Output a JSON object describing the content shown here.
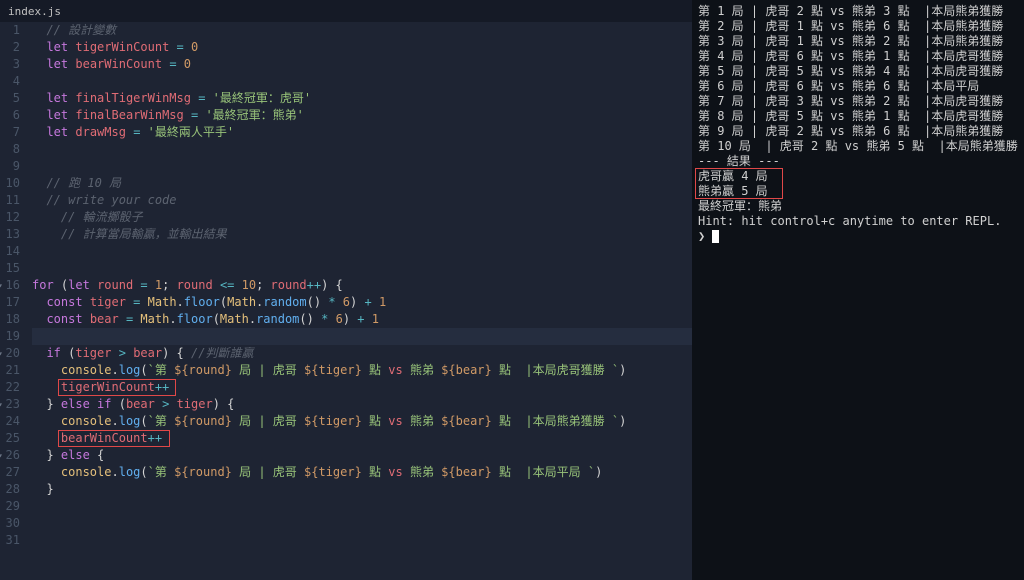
{
  "tab": {
    "filename": "index.js"
  },
  "code": {
    "lines": [
      {
        "n": 1,
        "seg": [
          [
            "",
            "  "
          ],
          [
            "cmt",
            "// 設計變數"
          ]
        ]
      },
      {
        "n": 2,
        "seg": [
          [
            "",
            "  "
          ],
          [
            "kw",
            "let"
          ],
          [
            "",
            " "
          ],
          [
            "var",
            "tigerWinCount"
          ],
          [
            "",
            " "
          ],
          [
            "op",
            "="
          ],
          [
            "",
            " "
          ],
          [
            "num",
            "0"
          ]
        ]
      },
      {
        "n": 3,
        "seg": [
          [
            "",
            "  "
          ],
          [
            "kw",
            "let"
          ],
          [
            "",
            " "
          ],
          [
            "var",
            "bearWinCount"
          ],
          [
            "",
            " "
          ],
          [
            "op",
            "="
          ],
          [
            "",
            " "
          ],
          [
            "num",
            "0"
          ]
        ]
      },
      {
        "n": 4,
        "seg": []
      },
      {
        "n": 5,
        "seg": [
          [
            "",
            "  "
          ],
          [
            "kw",
            "let"
          ],
          [
            "",
            " "
          ],
          [
            "var",
            "finalTigerWinMsg"
          ],
          [
            "",
            " "
          ],
          [
            "op",
            "="
          ],
          [
            "",
            " "
          ],
          [
            "str",
            "'最終冠軍：虎哥'"
          ]
        ]
      },
      {
        "n": 6,
        "seg": [
          [
            "",
            "  "
          ],
          [
            "kw",
            "let"
          ],
          [
            "",
            " "
          ],
          [
            "var",
            "finalBearWinMsg"
          ],
          [
            "",
            " "
          ],
          [
            "op",
            "="
          ],
          [
            "",
            " "
          ],
          [
            "str",
            "'最終冠軍：熊弟'"
          ]
        ]
      },
      {
        "n": 7,
        "seg": [
          [
            "",
            "  "
          ],
          [
            "kw",
            "let"
          ],
          [
            "",
            " "
          ],
          [
            "var",
            "drawMsg"
          ],
          [
            "",
            " "
          ],
          [
            "op",
            "="
          ],
          [
            "",
            " "
          ],
          [
            "str",
            "'最終兩人平手'"
          ]
        ]
      },
      {
        "n": 8,
        "seg": []
      },
      {
        "n": 9,
        "seg": []
      },
      {
        "n": 10,
        "seg": [
          [
            "",
            "  "
          ],
          [
            "cmt",
            "// 跑 10 局"
          ]
        ]
      },
      {
        "n": 11,
        "seg": [
          [
            "",
            "  "
          ],
          [
            "cmt",
            "// write your code"
          ]
        ]
      },
      {
        "n": 12,
        "seg": [
          [
            "",
            "    "
          ],
          [
            "cmt",
            "// 輪流擲骰子"
          ]
        ]
      },
      {
        "n": 13,
        "seg": [
          [
            "",
            "    "
          ],
          [
            "cmt",
            "// 計算當局輸贏，並輸出結果"
          ]
        ]
      },
      {
        "n": 14,
        "seg": []
      },
      {
        "n": 15,
        "seg": []
      },
      {
        "n": 16,
        "fold": true,
        "seg": [
          [
            "kw",
            "for"
          ],
          [
            "",
            " ("
          ],
          [
            "kw",
            "let"
          ],
          [
            "",
            " "
          ],
          [
            "var",
            "round"
          ],
          [
            "",
            " "
          ],
          [
            "op",
            "="
          ],
          [
            "",
            " "
          ],
          [
            "num",
            "1"
          ],
          [
            "",
            "; "
          ],
          [
            "var",
            "round"
          ],
          [
            "",
            " "
          ],
          [
            "op",
            "<="
          ],
          [
            "",
            " "
          ],
          [
            "num",
            "10"
          ],
          [
            "",
            "; "
          ],
          [
            "var",
            "round"
          ],
          [
            "op",
            "++"
          ],
          [
            "",
            ") {"
          ]
        ]
      },
      {
        "n": 17,
        "seg": [
          [
            "",
            "  "
          ],
          [
            "kw",
            "const"
          ],
          [
            "",
            " "
          ],
          [
            "var",
            "tiger"
          ],
          [
            "",
            " "
          ],
          [
            "op",
            "="
          ],
          [
            "",
            " "
          ],
          [
            "prop",
            "Math"
          ],
          [
            "",
            "."
          ],
          [
            "fn",
            "floor"
          ],
          [
            "",
            "("
          ],
          [
            "prop",
            "Math"
          ],
          [
            "",
            "."
          ],
          [
            "fn",
            "random"
          ],
          [
            "",
            "() "
          ],
          [
            "op",
            "*"
          ],
          [
            "",
            " "
          ],
          [
            "num",
            "6"
          ],
          [
            "",
            ") "
          ],
          [
            "op",
            "+"
          ],
          [
            "",
            " "
          ],
          [
            "num",
            "1"
          ]
        ]
      },
      {
        "n": 18,
        "seg": [
          [
            "",
            "  "
          ],
          [
            "kw",
            "const"
          ],
          [
            "",
            " "
          ],
          [
            "var",
            "bear"
          ],
          [
            "",
            " "
          ],
          [
            "op",
            "="
          ],
          [
            "",
            " "
          ],
          [
            "prop",
            "Math"
          ],
          [
            "",
            "."
          ],
          [
            "fn",
            "floor"
          ],
          [
            "",
            "("
          ],
          [
            "prop",
            "Math"
          ],
          [
            "",
            "."
          ],
          [
            "fn",
            "random"
          ],
          [
            "",
            "() "
          ],
          [
            "op",
            "*"
          ],
          [
            "",
            " "
          ],
          [
            "num",
            "6"
          ],
          [
            "",
            ") "
          ],
          [
            "op",
            "+"
          ],
          [
            "",
            " "
          ],
          [
            "num",
            "1"
          ]
        ]
      },
      {
        "n": 19,
        "cur": true,
        "seg": []
      },
      {
        "n": 20,
        "fold": true,
        "seg": [
          [
            "",
            "  "
          ],
          [
            "kw",
            "if"
          ],
          [
            "",
            " ("
          ],
          [
            "var",
            "tiger"
          ],
          [
            "",
            " "
          ],
          [
            "op",
            ">"
          ],
          [
            "",
            " "
          ],
          [
            "var",
            "bear"
          ],
          [
            "",
            ") { "
          ],
          [
            "cmt",
            "//判斷誰贏"
          ]
        ]
      },
      {
        "n": 21,
        "seg": [
          [
            "",
            "    "
          ],
          [
            "prop",
            "console"
          ],
          [
            "",
            "."
          ],
          [
            "fn",
            "log"
          ],
          [
            "",
            "("
          ],
          [
            "tmpl",
            "`第 "
          ],
          [
            "tvar",
            "${round}"
          ],
          [
            "tmpl",
            " 局 | 虎哥 "
          ],
          [
            "tvar",
            "${tiger}"
          ],
          [
            "tmpl",
            " 點 "
          ],
          [
            "var",
            "vs"
          ],
          [
            "tmpl",
            " 熊弟 "
          ],
          [
            "tvar",
            "${bear}"
          ],
          [
            "tmpl",
            " 點  |本局虎哥獲勝 `"
          ],
          [
            "",
            ")"
          ]
        ]
      },
      {
        "n": 22,
        "seg": [
          [
            "",
            "    "
          ],
          [
            "var",
            "tigerWinCount"
          ],
          [
            "op",
            "++"
          ]
        ]
      },
      {
        "n": 23,
        "fold": true,
        "seg": [
          [
            "",
            "  } "
          ],
          [
            "kw",
            "else"
          ],
          [
            "",
            " "
          ],
          [
            "kw",
            "if"
          ],
          [
            "",
            " ("
          ],
          [
            "var",
            "bear"
          ],
          [
            "",
            " "
          ],
          [
            "op",
            ">"
          ],
          [
            "",
            " "
          ],
          [
            "var",
            "tiger"
          ],
          [
            "",
            ") {"
          ]
        ]
      },
      {
        "n": 24,
        "seg": [
          [
            "",
            "    "
          ],
          [
            "prop",
            "console"
          ],
          [
            "",
            "."
          ],
          [
            "fn",
            "log"
          ],
          [
            "",
            "("
          ],
          [
            "tmpl",
            "`第 "
          ],
          [
            "tvar",
            "${round}"
          ],
          [
            "tmpl",
            " 局 | 虎哥 "
          ],
          [
            "tvar",
            "${tiger}"
          ],
          [
            "tmpl",
            " 點 "
          ],
          [
            "var",
            "vs"
          ],
          [
            "tmpl",
            " 熊弟 "
          ],
          [
            "tvar",
            "${bear}"
          ],
          [
            "tmpl",
            " 點  |本局熊弟獲勝 `"
          ],
          [
            "",
            ")"
          ]
        ]
      },
      {
        "n": 25,
        "seg": [
          [
            "",
            "    "
          ],
          [
            "var",
            "bearWinCount"
          ],
          [
            "op",
            "++"
          ]
        ]
      },
      {
        "n": 26,
        "fold": true,
        "seg": [
          [
            "",
            "  } "
          ],
          [
            "kw",
            "else"
          ],
          [
            "",
            " {"
          ]
        ]
      },
      {
        "n": 27,
        "seg": [
          [
            "",
            "    "
          ],
          [
            "prop",
            "console"
          ],
          [
            "",
            "."
          ],
          [
            "fn",
            "log"
          ],
          [
            "",
            "("
          ],
          [
            "tmpl",
            "`第 "
          ],
          [
            "tvar",
            "${round}"
          ],
          [
            "tmpl",
            " 局 | 虎哥 "
          ],
          [
            "tvar",
            "${tiger}"
          ],
          [
            "tmpl",
            " 點 "
          ],
          [
            "var",
            "vs"
          ],
          [
            "tmpl",
            " 熊弟 "
          ],
          [
            "tvar",
            "${bear}"
          ],
          [
            "tmpl",
            " 點  |本局平局 `"
          ],
          [
            "",
            ")"
          ]
        ]
      },
      {
        "n": 28,
        "seg": [
          [
            "",
            "  }"
          ]
        ]
      },
      {
        "n": 29,
        "seg": []
      },
      {
        "n": 30,
        "seg": []
      },
      {
        "n": 31,
        "seg": []
      }
    ]
  },
  "redboxes": {
    "box1": {
      "line_hint": "tigerWinCount++"
    },
    "box2": {
      "line_hint": "bearWinCount++"
    }
  },
  "terminal": {
    "rounds": [
      "第 1 局 | 虎哥 2 點 vs 熊弟 3 點  |本局熊弟獲勝",
      "第 2 局 | 虎哥 1 點 vs 熊弟 6 點  |本局熊弟獲勝",
      "第 3 局 | 虎哥 1 點 vs 熊弟 2 點  |本局熊弟獲勝",
      "第 4 局 | 虎哥 6 點 vs 熊弟 1 點  |本局虎哥獲勝",
      "第 5 局 | 虎哥 5 點 vs 熊弟 4 點  |本局虎哥獲勝",
      "第 6 局 | 虎哥 6 點 vs 熊弟 6 點  |本局平局",
      "第 7 局 | 虎哥 3 點 vs 熊弟 2 點  |本局虎哥獲勝",
      "第 8 局 | 虎哥 5 點 vs 熊弟 1 點  |本局虎哥獲勝",
      "第 9 局 | 虎哥 2 點 vs 熊弟 6 點  |本局熊弟獲勝",
      "第 10 局  | 虎哥 2 點 vs 熊弟 5 點  |本局熊弟獲勝"
    ],
    "divider": "--- 結果 ---",
    "summary": [
      "虎哥贏 4 局",
      "熊弟贏 5 局"
    ],
    "final": "最終冠軍：熊弟",
    "hint": "Hint: hit control+c anytime to enter REPL.",
    "prompt": "❯ "
  }
}
